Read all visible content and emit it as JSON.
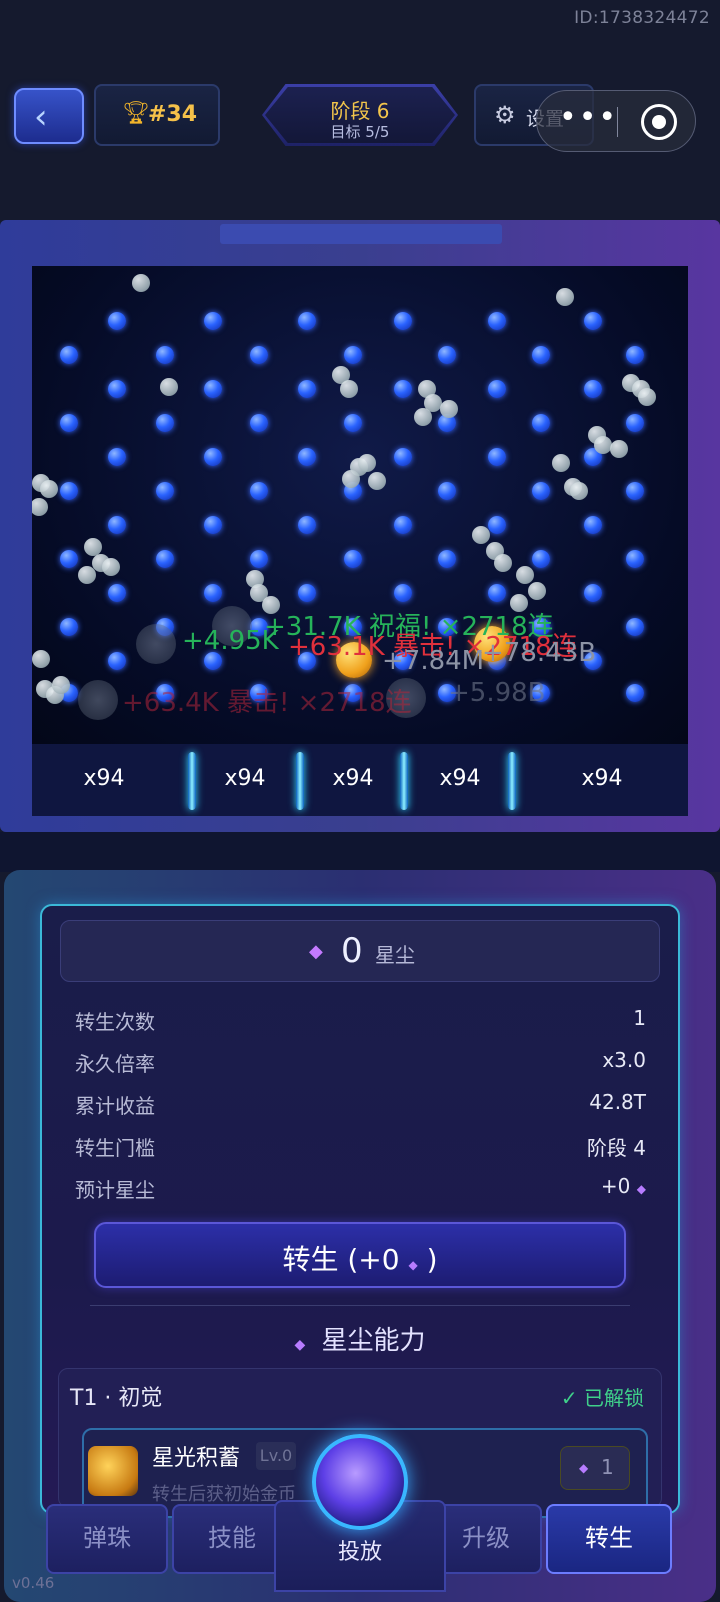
{
  "header": {
    "id_text": "ID:1738324472",
    "rank": "#34",
    "stage_title": "阶段 6",
    "stage_target": "目标 5/5",
    "settings_label": "设置",
    "back_icon": "chevron-left-icon",
    "trophy_icon": "trophy-icon",
    "gear_icon": "gear-icon",
    "capsule_more": "•••"
  },
  "board": {
    "float_texts": [
      "+31.7K 祝福! ×2718连",
      "+4.95K",
      "+63.1K 暴击! ×2718连",
      "+7.84M",
      "+78.43B",
      "+63.4K 暴击! ×2718连",
      "+5.98B"
    ],
    "multipliers": [
      "x94",
      "x94",
      "x94",
      "x94",
      "x94"
    ]
  },
  "rebirth": {
    "stardust_value": "0",
    "stardust_unit": "星尘",
    "stats": [
      {
        "label": "转生次数",
        "value": "1"
      },
      {
        "label": "永久倍率",
        "value": "x3.0"
      },
      {
        "label": "累计收益",
        "value": "42.8T"
      },
      {
        "label": "转生门槛",
        "value": "阶段 4"
      },
      {
        "label": "预计星尘",
        "value": "+0"
      }
    ],
    "button_prefix": "转生 (+0",
    "button_suffix": ")"
  },
  "abilities": {
    "section_title": "星尘能力",
    "tier_name": "T1 · 初觉",
    "tier_status": "✓ 已解锁",
    "skill_name": "星光积蓄",
    "skill_level": "Lv.0",
    "skill_cost": "1",
    "skill_desc": "转生后获初始金币"
  },
  "tabs": {
    "marbles": "弹珠",
    "skills": "技能",
    "launch": "投放",
    "upgrade": "升级",
    "rebirth": "转生"
  },
  "version": "v0.46",
  "colors": {
    "accent_gold": "#f3c54b",
    "peg_blue": "#2a63ff",
    "unlocked_green": "#3fd08a",
    "gem_purple": "#b77cff"
  }
}
